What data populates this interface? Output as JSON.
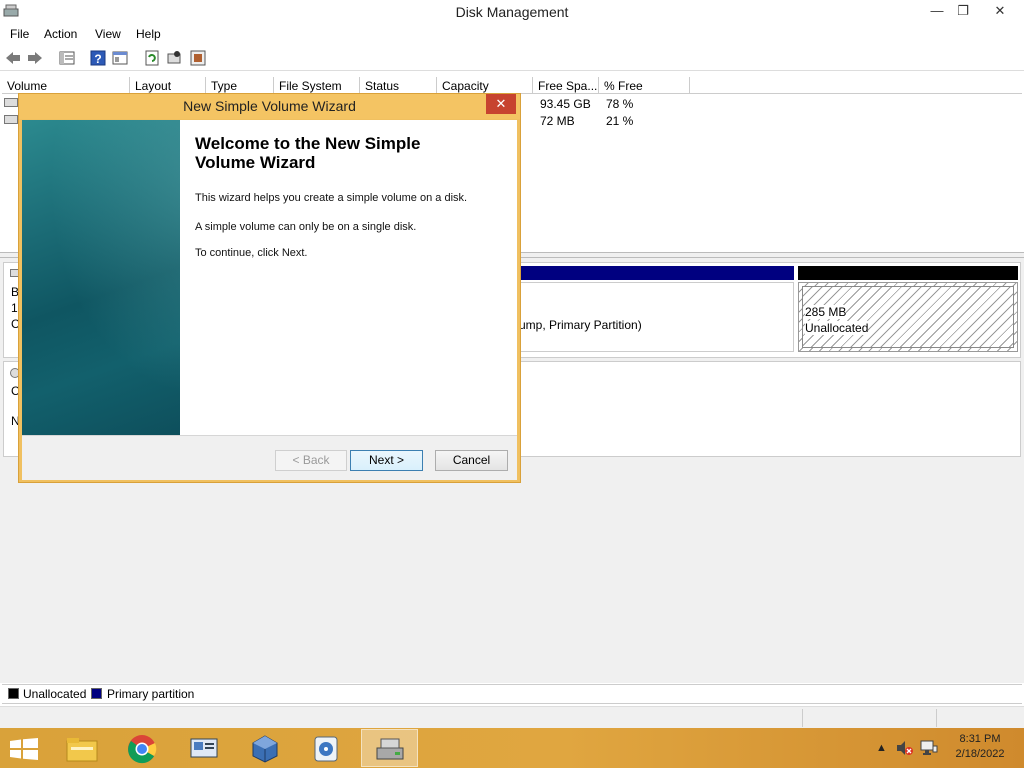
{
  "window": {
    "title": "Disk Management",
    "controls": {
      "minimize": "—",
      "maximize": "❐",
      "close": "✕"
    }
  },
  "menu": [
    "File",
    "Action",
    "View",
    "Help"
  ],
  "toolbar_icons": [
    "back-icon",
    "forward-icon",
    "list-view-icon",
    "help-icon",
    "properties-icon",
    "refresh-icon",
    "rescan-icon",
    "settings-icon"
  ],
  "columns": [
    "Volume",
    "Layout",
    "Type",
    "File System",
    "Status",
    "Capacity",
    "Free Spa...",
    "% Free"
  ],
  "rows": [
    {
      "free_space": "93.45 GB",
      "percent_free": "78 %"
    },
    {
      "free_space": "72 MB",
      "percent_free": "21 %"
    }
  ],
  "disk_view": {
    "disk0_labels": [
      "B",
      "1",
      "C"
    ],
    "disk1_labels": [
      "C",
      "N"
    ],
    "partition_text": "ump, Primary Partition)",
    "unallocated_size": "285 MB",
    "unallocated_label": "Unallocated"
  },
  "legend": {
    "unallocated": "Unallocated",
    "primary": "Primary partition",
    "colors": {
      "unallocated": "#000000",
      "primary": "#000080"
    }
  },
  "wizard": {
    "title": "New Simple Volume Wizard",
    "close": "✕",
    "heading": "Welcome to the New Simple Volume Wizard",
    "p1": "This wizard helps you create a simple volume on a disk.",
    "p2": "A simple volume can only be on a single disk.",
    "p3": "To continue, click Next.",
    "back_label": "< Back",
    "next_label": "Next >",
    "cancel_label": "Cancel"
  },
  "taskbar": {
    "items": [
      "windows-start-icon",
      "file-explorer-icon",
      "chrome-icon",
      "computer-management-icon",
      "virtualbox-icon",
      "media-icon",
      "disk-management-icon"
    ],
    "time": "8:31 PM",
    "date": "2/18/2022"
  }
}
